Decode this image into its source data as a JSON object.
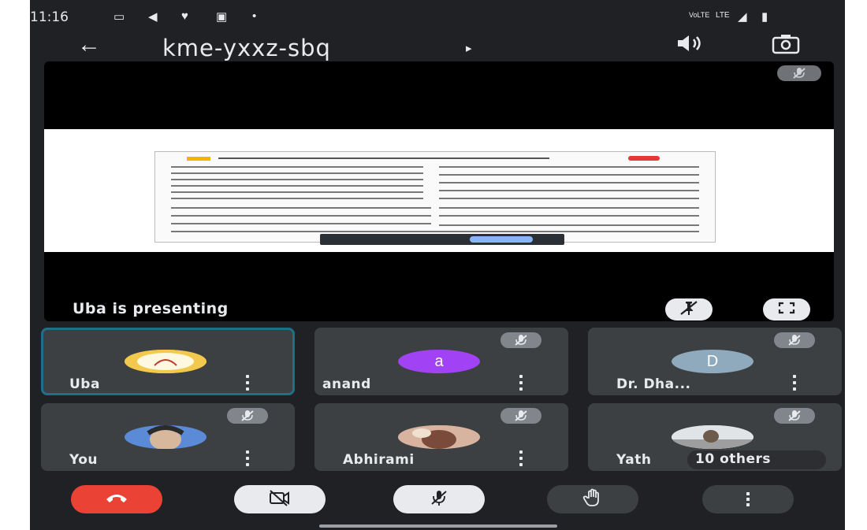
{
  "status_bar": {
    "time": "11:16",
    "left_icons": [
      "camera-icon",
      "navigation-icon",
      "chat-icon",
      "gallery-icon",
      "dot-icon"
    ],
    "right_icons": [
      "volte-icon",
      "lte-signal-icon",
      "signal-icon",
      "battery-icon"
    ]
  },
  "header": {
    "meeting_code": "kme-yxxz-sbq",
    "caret": "▸"
  },
  "presentation": {
    "presenting_label": "Uba is presenting"
  },
  "participants": [
    {
      "name": "Uba",
      "avatar_type": "image",
      "muted": false,
      "active": true
    },
    {
      "name": "anand",
      "avatar_type": "letter",
      "avatar_letter": "a",
      "avatar_color": "#a142f4",
      "muted": true,
      "active": false
    },
    {
      "name": "Dr. Dha...",
      "avatar_type": "letter",
      "avatar_letter": "D",
      "avatar_color": "#8fa9bd",
      "muted": true,
      "active": false
    },
    {
      "name": "You",
      "avatar_type": "image",
      "muted": true,
      "active": false
    },
    {
      "name": "Abhirami",
      "avatar_type": "image",
      "muted": true,
      "active": false
    },
    {
      "name": "Yath",
      "avatar_type": "image",
      "muted": true,
      "active": false
    }
  ],
  "others": {
    "label": "10 others"
  },
  "controls": {
    "end_call": {
      "icon": "end-call-icon",
      "color": "#ea4335"
    },
    "camera": {
      "icon": "camera-off-icon",
      "color": "#e8eaed"
    },
    "mic": {
      "icon": "mic-off-icon",
      "color": "#e8eaed"
    },
    "raise_hand": {
      "icon": "raise-hand-icon",
      "color": "#3c4043"
    },
    "more": {
      "icon": "more-vert-icon",
      "color": "#3c4043"
    }
  }
}
